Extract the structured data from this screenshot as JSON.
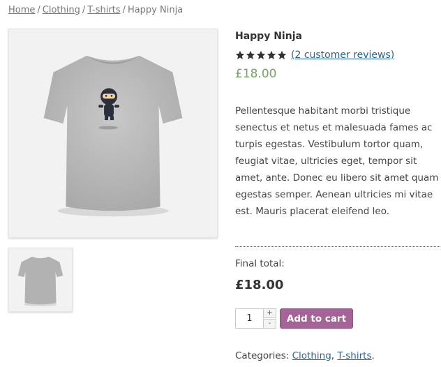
{
  "breadcrumb": {
    "home": "Home",
    "clothing": "Clothing",
    "tshirts": "T-shirts",
    "current": "Happy Ninja",
    "separator": "/"
  },
  "product": {
    "title": "Happy Ninja",
    "rating_stars": 5,
    "reviews_link": "(2 customer reviews)",
    "price": "£18.00",
    "description": "Pellentesque habitant morbi tristique senectus et netus et malesuada fames ac turpis egestas. Vestibulum tortor quam, feugiat vitae, ultricies eget, tempor sit amet, ante. Donec eu libero sit amet quam egestas semper. Aenean ultricies mi vitae est. Mauris placerat eleifend leo.",
    "final_total_label": "Final total:",
    "final_total": "£18.00",
    "quantity": "1",
    "qty_plus": "+",
    "qty_minus": "-",
    "add_to_cart": "Add to cart",
    "categories_label": "Categories:",
    "category_1": "Clothing",
    "category_sep": ",",
    "category_2": "T-shirts",
    "categories_end": "."
  },
  "colors": {
    "price_green": "#77a464",
    "button_purple": "#a46497",
    "link_blue": "#2a6496",
    "shirt_gray": "#b9b9b9"
  },
  "icons": [
    "star-icon",
    "ninja-shirt-image",
    "shirt-back-image"
  ]
}
